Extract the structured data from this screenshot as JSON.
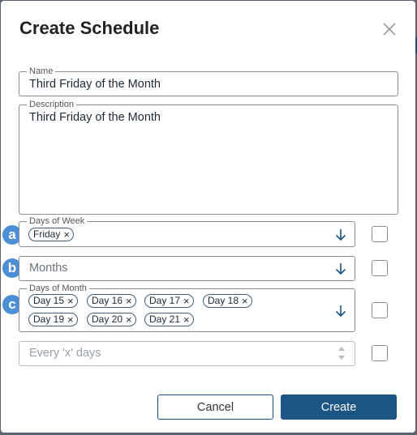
{
  "dialog": {
    "title": "Create Schedule",
    "close_icon": "close-icon"
  },
  "name": {
    "legend": "Name",
    "value": "Third Friday of the Month"
  },
  "description": {
    "legend": "Description",
    "value": "Third Friday of the Month"
  },
  "days_of_week": {
    "badge": "a",
    "legend": "Days of Week",
    "chips": [
      "Friday"
    ]
  },
  "months": {
    "badge": "b",
    "placeholder": "Months"
  },
  "days_of_month": {
    "badge": "c",
    "legend": "Days of Month",
    "chips": [
      "Day 15",
      "Day 16",
      "Day 17",
      "Day 18",
      "Day 19",
      "Day 20",
      "Day 21"
    ]
  },
  "every_x_days": {
    "placeholder": "Every 'x' days"
  },
  "buttons": {
    "cancel": "Cancel",
    "create": "Create"
  },
  "colors": {
    "accent": "#1b5585",
    "badge": "#4d8fd6"
  }
}
